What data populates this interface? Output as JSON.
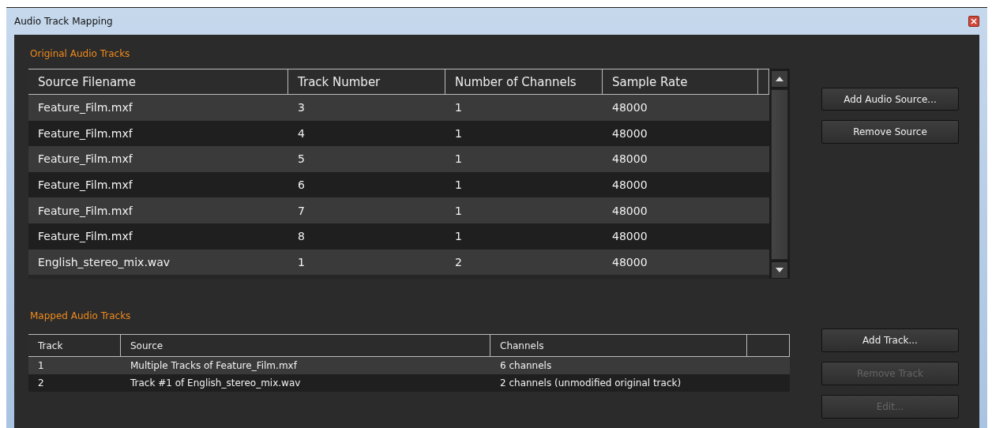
{
  "window": {
    "title": "Audio Track Mapping"
  },
  "original_tracks": {
    "heading": "Original Audio Tracks",
    "columns": [
      "Source Filename",
      "Track Number",
      "Number of Channels",
      "Sample Rate"
    ],
    "rows": [
      [
        "Feature_Film.mxf",
        "3",
        "1",
        "48000"
      ],
      [
        "Feature_Film.mxf",
        "4",
        "1",
        "48000"
      ],
      [
        "Feature_Film.mxf",
        "5",
        "1",
        "48000"
      ],
      [
        "Feature_Film.mxf",
        "6",
        "1",
        "48000"
      ],
      [
        "Feature_Film.mxf",
        "7",
        "1",
        "48000"
      ],
      [
        "Feature_Film.mxf",
        "8",
        "1",
        "48000"
      ],
      [
        "English_stereo_mix.wav",
        "1",
        "2",
        "48000"
      ]
    ],
    "buttons": [
      {
        "label": "Add Audio Source...",
        "disabled": false
      },
      {
        "label": "Remove Source",
        "disabled": false
      }
    ]
  },
  "mapped_tracks": {
    "heading": "Mapped Audio Tracks",
    "columns": [
      "Track",
      "Source",
      "Channels"
    ],
    "rows": [
      [
        "1",
        "Multiple Tracks of Feature_Film.mxf",
        "6 channels"
      ],
      [
        "2",
        "Track #1 of English_stereo_mix.wav",
        "2 channels (unmodified original track)"
      ]
    ],
    "buttons": [
      {
        "label": "Add Track...",
        "disabled": false
      },
      {
        "label": "Remove Track",
        "disabled": true
      },
      {
        "label": "Edit...",
        "disabled": true
      }
    ]
  }
}
